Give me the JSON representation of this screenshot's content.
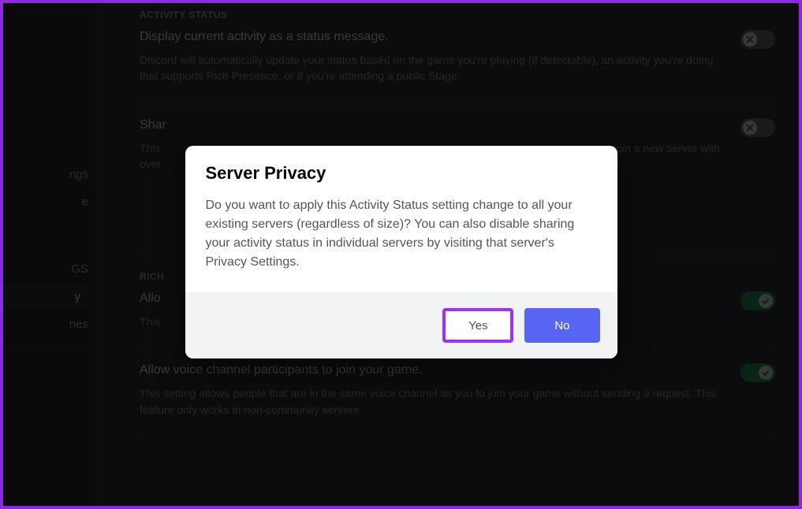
{
  "sidebar": {
    "items": [
      {
        "label": "ngs"
      },
      {
        "label": "e"
      },
      {
        "label": "GS"
      },
      {
        "label": "y"
      },
      {
        "label": "nes"
      }
    ]
  },
  "sections": {
    "activity_status": {
      "label": "ACTIVITY STATUS",
      "display_activity": {
        "title": "Display current activity as a status message.",
        "desc": "Discord will automatically update your status based on the game you're playing (if detectable), an activity you're doing that supports Rich Presence, or if you're attending a public Stage."
      },
      "share_large": {
        "title": "Shar",
        "desc_line1": "This",
        "desc_line2": "over",
        "desc_trail": "en you join a new server with"
      }
    },
    "rich": {
      "label": "RICH",
      "allow": {
        "title": "Allo",
        "desc": "This"
      },
      "voice_join": {
        "title": "Allow voice channel participants to join your game.",
        "desc": "This setting allows people that are in the same voice channel as you to join your game without sending a request. This feature only works in non-community servers."
      }
    }
  },
  "modal": {
    "title": "Server Privacy",
    "text": "Do you want to apply this Activity Status setting change to all your existing servers (regardless of size)? You can also disable sharing your activity status in individual servers by visiting that server's Privacy Settings.",
    "yes": "Yes",
    "no": "No"
  }
}
